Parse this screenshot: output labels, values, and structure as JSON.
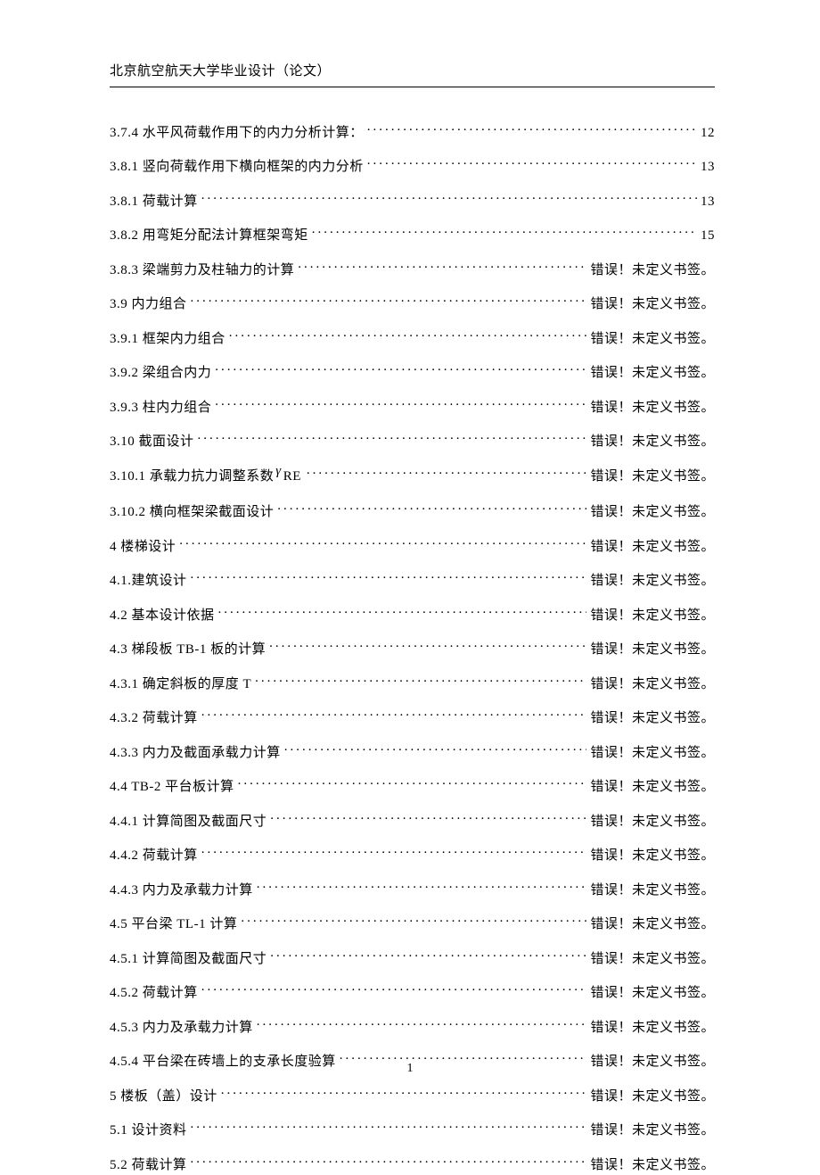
{
  "header": {
    "title": "北京航空航天大学毕业设计（论文）"
  },
  "error_text": "错误！未定义书签。",
  "toc": [
    {
      "title": "3.7.4 水平风荷载作用下的内力分析计算：",
      "page": "12",
      "type": "num"
    },
    {
      "title": "3.8.1  竖向荷载作用下横向框架的内力分析",
      "page": "13",
      "type": "num"
    },
    {
      "title": "3.8.1 荷载计算",
      "page": "13",
      "type": "num"
    },
    {
      "title": "3.8.2 用弯矩分配法计算框架弯矩",
      "page": "15",
      "type": "num"
    },
    {
      "title": "3.8.3 梁端剪力及柱轴力的计算",
      "page": "err",
      "type": "err"
    },
    {
      "title": "3.9  内力组合",
      "page": "err",
      "type": "err"
    },
    {
      "title": "3.9.1 框架内力组合",
      "page": "err",
      "type": "err"
    },
    {
      "title": "3.9.2 梁组合内力",
      "page": "err",
      "type": "err"
    },
    {
      "title": "3.9.3 柱内力组合",
      "page": "err",
      "type": "err"
    },
    {
      "title": "3.10  截面设计",
      "page": "err",
      "type": "err"
    },
    {
      "title_pre": "3.10.1 承载力抗力调整系数",
      "title_suf": "",
      "page": "err",
      "type": "err",
      "gamma": true,
      "gamma_char": "γ",
      "gamma_sub": "RE"
    },
    {
      "title": "3.10.2 横向框架梁截面设计",
      "page": "err",
      "type": "err"
    },
    {
      "title": "4 楼梯设计",
      "page": "err",
      "type": "err"
    },
    {
      "title": "4.1.建筑设计",
      "page": "err",
      "type": "err"
    },
    {
      "title": "4.2 基本设计依据",
      "page": "err",
      "type": "err"
    },
    {
      "title": "4.3 梯段板 TB-1 板的计算",
      "page": "err",
      "type": "err"
    },
    {
      "title": "4.3.1  确定斜板的厚度 T",
      "page": "err",
      "type": "err"
    },
    {
      "title": "4.3.2 荷载计算",
      "page": "err",
      "type": "err"
    },
    {
      "title": "4.3.3 内力及截面承载力计算",
      "page": "err",
      "type": "err"
    },
    {
      "title": "4.4 TB-2 平台板计算",
      "page": "err",
      "type": "err"
    },
    {
      "title": "4.4.1  计算简图及截面尺寸",
      "page": "err",
      "type": "err"
    },
    {
      "title": "4.4.2 荷载计算",
      "page": "err",
      "type": "err"
    },
    {
      "title": "4.4.3 内力及承载力计算",
      "page": "err",
      "type": "err"
    },
    {
      "title": "4.5 平台梁 TL-1 计算",
      "page": "err",
      "type": "err"
    },
    {
      "title": "4.5.1  计算简图及截面尺寸",
      "page": "err",
      "type": "err"
    },
    {
      "title": "4.5.2 荷载计算",
      "page": "err",
      "type": "err"
    },
    {
      "title": "4.5.3 内力及承载力计算",
      "page": "err",
      "type": "err"
    },
    {
      "title": "4.5.4 平台梁在砖墙上的支承长度验算",
      "page": "err",
      "type": "err"
    },
    {
      "title": "5 楼板（盖）设计",
      "page": "err",
      "type": "err"
    },
    {
      "title": "5.1 设计资料",
      "page": "err",
      "type": "err"
    },
    {
      "title": "5.2 荷载计算",
      "page": "err",
      "type": "err"
    }
  ],
  "footer": {
    "page_number": "1"
  }
}
